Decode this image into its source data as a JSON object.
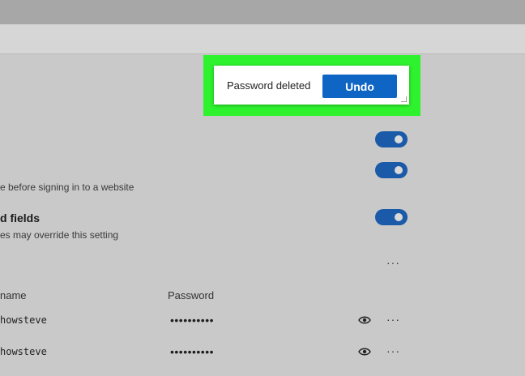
{
  "toast": {
    "message": "Password deleted",
    "undo_label": "Undo"
  },
  "settings": {
    "toggle_1": {
      "on": true
    },
    "toggle_2": {
      "on": true,
      "description": "e before signing in to a website"
    },
    "toggle_3": {
      "on": true,
      "heading": "d fields",
      "description": "es may override this setting"
    }
  },
  "more_menu_glyph": "···",
  "passwords": {
    "columns": {
      "username": "name",
      "password": "Password"
    },
    "rows": [
      {
        "username": "howsteve",
        "password": "••••••••••"
      },
      {
        "username": "howsteve",
        "password": "••••••••••"
      }
    ]
  },
  "colors": {
    "highlight": "#2ef22e",
    "toggle_on": "#1a5aa8",
    "undo_button": "#0f65c4"
  }
}
